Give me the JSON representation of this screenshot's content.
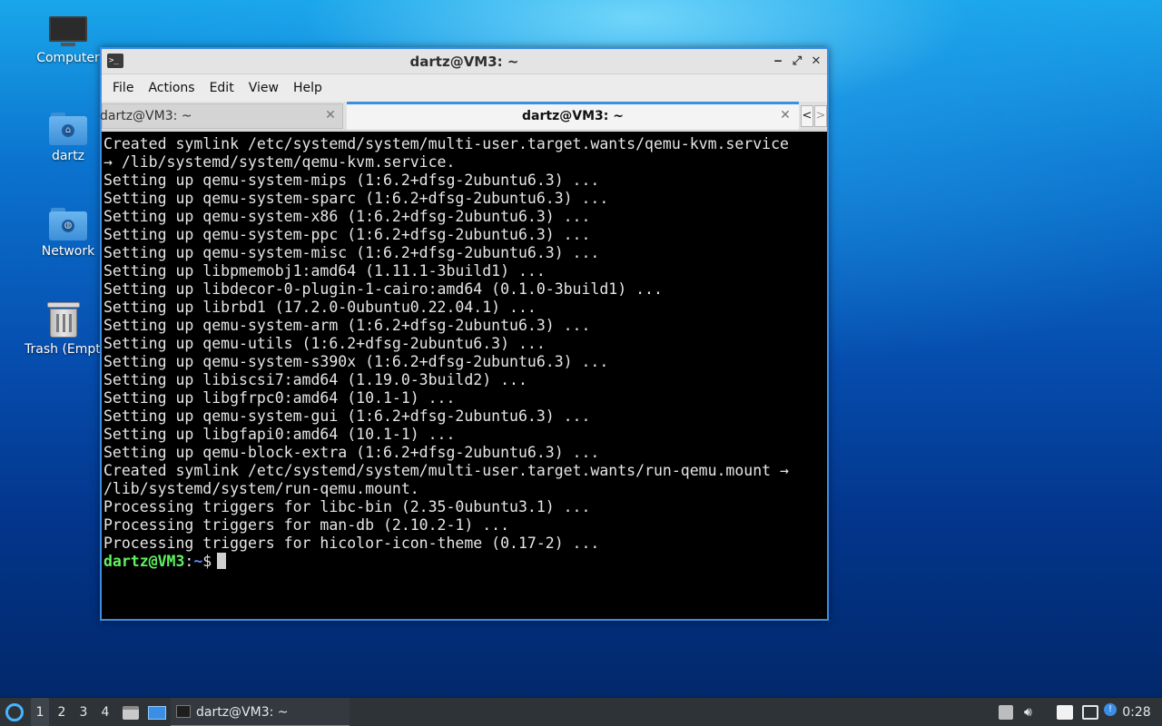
{
  "desktop": {
    "icons": [
      {
        "label": "Computer",
        "icon": "computer-icon"
      },
      {
        "label": "dartz",
        "icon": "home-folder-icon"
      },
      {
        "label": "Network",
        "icon": "network-folder-icon"
      },
      {
        "label": "Trash (Empty)",
        "icon": "trash-icon"
      }
    ]
  },
  "window": {
    "title": "dartz@VM3: ~",
    "controls": {
      "minimize": "‒",
      "maximize": "⤢",
      "close": "✕"
    },
    "menu": [
      "File",
      "Actions",
      "Edit",
      "View",
      "Help"
    ],
    "tabs": [
      {
        "label": "dartz@VM3: ~",
        "active": false
      },
      {
        "label": "dartz@VM3: ~",
        "active": true
      }
    ],
    "tab_close_glyph": "✕",
    "tab_scroll": {
      "left": "<",
      "right": ">"
    }
  },
  "terminal": {
    "lines": [
      "Created symlink /etc/systemd/system/multi-user.target.wants/qemu-kvm.service",
      "→ /lib/systemd/system/qemu-kvm.service.",
      "Setting up qemu-system-mips (1:6.2+dfsg-2ubuntu6.3) ...",
      "Setting up qemu-system-sparc (1:6.2+dfsg-2ubuntu6.3) ...",
      "Setting up qemu-system-x86 (1:6.2+dfsg-2ubuntu6.3) ...",
      "Setting up qemu-system-ppc (1:6.2+dfsg-2ubuntu6.3) ...",
      "Setting up qemu-system-misc (1:6.2+dfsg-2ubuntu6.3) ...",
      "Setting up libpmemobj1:amd64 (1.11.1-3build1) ...",
      "Setting up libdecor-0-plugin-1-cairo:amd64 (0.1.0-3build1) ...",
      "Setting up librbd1 (17.2.0-0ubuntu0.22.04.1) ...",
      "Setting up qemu-system-arm (1:6.2+dfsg-2ubuntu6.3) ...",
      "Setting up qemu-utils (1:6.2+dfsg-2ubuntu6.3) ...",
      "Setting up qemu-system-s390x (1:6.2+dfsg-2ubuntu6.3) ...",
      "Setting up libiscsi7:amd64 (1.19.0-3build2) ...",
      "Setting up libgfrpc0:amd64 (10.1-1) ...",
      "Setting up qemu-system-gui (1:6.2+dfsg-2ubuntu6.3) ...",
      "Setting up libgfapi0:amd64 (10.1-1) ...",
      "Setting up qemu-block-extra (1:6.2+dfsg-2ubuntu6.3) ...",
      "Created symlink /etc/systemd/system/multi-user.target.wants/run-qemu.mount →",
      "/lib/systemd/system/run-qemu.mount.",
      "Processing triggers for libc-bin (2.35-0ubuntu3.1) ...",
      "Processing triggers for man-db (2.10.2-1) ...",
      "Processing triggers for hicolor-icon-theme (0.17-2) ..."
    ],
    "prompt": {
      "user_host": "dartz@VM3",
      "sep": ":",
      "path": "~",
      "symbol": "$"
    }
  },
  "taskbar": {
    "workspaces": [
      "1",
      "2",
      "3",
      "4"
    ],
    "active_workspace": "1",
    "task_label": "dartz@VM3: ~",
    "clock": "0:28"
  },
  "colors": {
    "accent": "#3a8ee6",
    "prompt_user": "#5ff35f",
    "prompt_path": "#5f8fff",
    "terminal_bg": "#000000"
  }
}
